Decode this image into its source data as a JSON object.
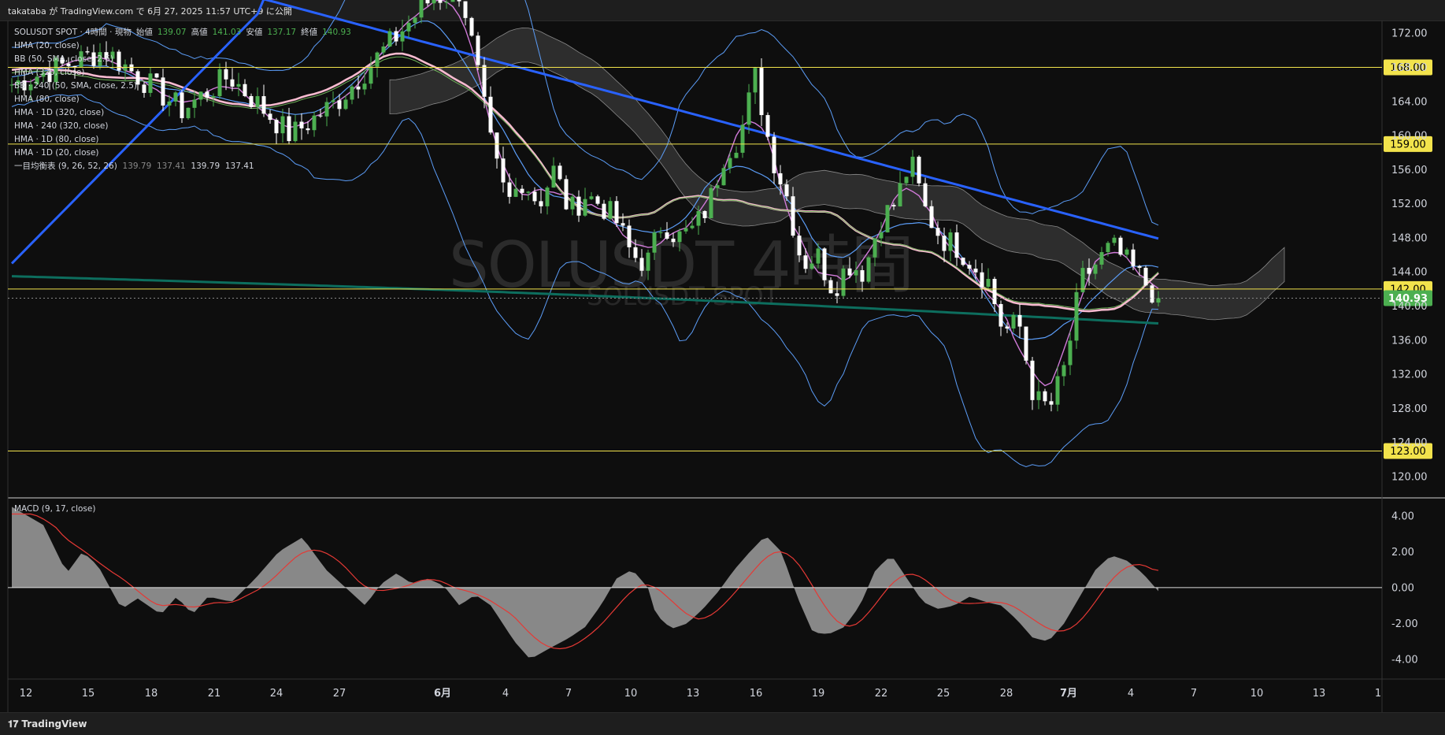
{
  "header": {
    "publish_text": "takataba が TradingView.com で 6月 27, 2025 11:57 UTC+9 に公開"
  },
  "legend": {
    "symbol": "SOLUSDT SPOT · 4時間 · 現物",
    "open_label": "始値",
    "open": "139.07",
    "high_label": "高値",
    "high": "141.03",
    "low_label": "安値",
    "low": "137.17",
    "close_label": "終値",
    "close": "140.93",
    "indicators": [
      "HMA (20, close)",
      "BB (50, SMA, close, 2.5)",
      "HMA (320, close)",
      "BB · 240 (50, SMA, close, 2.5)",
      "HMA (80, close)",
      "HMA · 1D (320, close)",
      "HMA · 240 (320, close)",
      "HMA · 1D (80, close)",
      "HMA · 1D (20, close)"
    ],
    "ichimoku_label": "一目均衡表 (9, 26, 52, 26)",
    "ichimoku_values": [
      "139.79",
      "137.41",
      "139.79",
      "137.41"
    ]
  },
  "watermark": {
    "main": "SOLUSDT 4時間",
    "sub": "SOLUSDT SPOT"
  },
  "macd_label": "MACD (9, 17, close)",
  "footer": {
    "brand": "TradingView"
  },
  "colors": {
    "bg": "#0e0e0e",
    "up": "#4caf50",
    "down": "#ffffff",
    "hline": "#f2e34c",
    "hma_blue": "#2962ff",
    "hma_pink": "#f8bbd0",
    "hma_teal": "#0d6e5e",
    "bb": "#5b9cf6",
    "magenta": "#d07ad8",
    "green_ma": "#6fb25a",
    "cloud": "#3a3a3a",
    "macd_hist": "#9e9e9e",
    "signal": "#e53935",
    "price_tag": "#4caf50"
  },
  "chart_data": {
    "type": "candlestick",
    "x_axis_labels": [
      "12",
      "15",
      "18",
      "21",
      "24",
      "27",
      "6月",
      "4",
      "7",
      "10",
      "13",
      "16",
      "19",
      "22",
      "25",
      "28",
      "7月",
      "4",
      "7",
      "10",
      "13",
      "1"
    ],
    "y_ticks": [
      "172.00",
      "168.00",
      "164.00",
      "160.00",
      "156.00",
      "152.00",
      "148.00",
      "144.00",
      "140.00",
      "136.00",
      "132.00",
      "128.00",
      "124.00",
      "120.00"
    ],
    "y_range": [
      117.5,
      173.5
    ],
    "horizontal_levels": [
      "168.00",
      "159.00",
      "142.00",
      "123.00"
    ],
    "current_price": "140.93",
    "close_path": [
      [
        0,
        166
      ],
      [
        6,
        170
      ],
      [
        11,
        163
      ],
      [
        14,
        167
      ],
      [
        18,
        160
      ],
      [
        21,
        164
      ],
      [
        24,
        170
      ],
      [
        27,
        176
      ],
      [
        29,
        177
      ],
      [
        30,
        168
      ],
      [
        31,
        158
      ],
      [
        32,
        152
      ],
      [
        33,
        155
      ],
      [
        34,
        152
      ],
      [
        35,
        156
      ],
      [
        36,
        151
      ],
      [
        37,
        153
      ],
      [
        38,
        152
      ],
      [
        39,
        150
      ],
      [
        40,
        146
      ],
      [
        41,
        145
      ],
      [
        42,
        150
      ],
      [
        43,
        148
      ],
      [
        44,
        149
      ],
      [
        45,
        152
      ],
      [
        46,
        158
      ],
      [
        47,
        160
      ],
      [
        48,
        167
      ],
      [
        49,
        158
      ],
      [
        50,
        153
      ],
      [
        51,
        145
      ],
      [
        52,
        146
      ],
      [
        53,
        142
      ],
      [
        54,
        145
      ],
      [
        55,
        144
      ],
      [
        56,
        150
      ],
      [
        57,
        152
      ],
      [
        58,
        157
      ],
      [
        59,
        151
      ],
      [
        60,
        148
      ],
      [
        61,
        147
      ],
      [
        62,
        145
      ],
      [
        63,
        143
      ],
      [
        64,
        137
      ],
      [
        65,
        138
      ],
      [
        66,
        129
      ],
      [
        67,
        128
      ],
      [
        68,
        133
      ],
      [
        69,
        143
      ],
      [
        70,
        145
      ],
      [
        71,
        147
      ],
      [
        72,
        145
      ],
      [
        73,
        143
      ],
      [
        74,
        140.93
      ]
    ],
    "macd": {
      "label": "MACD (9, 17, close)",
      "y_ticks": [
        "4.00",
        "2.00",
        "0.00",
        "-2.00",
        "-4.00"
      ],
      "y_range": [
        -5.1,
        5.0
      ],
      "hist_path": [
        [
          0,
          4.5
        ],
        [
          2,
          3.5
        ],
        [
          3.5,
          0.8
        ],
        [
          4.5,
          2
        ],
        [
          5.5,
          1.2
        ],
        [
          7,
          -1.2
        ],
        [
          8,
          -0.6
        ],
        [
          9.5,
          -1.5
        ],
        [
          10.5,
          -0.5
        ],
        [
          11.5,
          -1.5
        ],
        [
          12.5,
          -0.5
        ],
        [
          14,
          -0.8
        ],
        [
          15.5,
          0.5
        ],
        [
          17,
          2
        ],
        [
          18.5,
          2.8
        ],
        [
          20,
          1
        ],
        [
          21.5,
          -0.2
        ],
        [
          22.5,
          -1
        ],
        [
          23.5,
          0.2
        ],
        [
          24.5,
          0.8
        ],
        [
          25.5,
          0.2
        ],
        [
          26.5,
          0.5
        ],
        [
          27.5,
          0.1
        ],
        [
          28.5,
          -1
        ],
        [
          29.5,
          -0.4
        ],
        [
          30.5,
          -1
        ],
        [
          32,
          -3
        ],
        [
          33,
          -4
        ],
        [
          34,
          -3.5
        ],
        [
          35.5,
          -2.8
        ],
        [
          36.5,
          -2.2
        ],
        [
          37.5,
          -1
        ],
        [
          38.5,
          0.5
        ],
        [
          39.5,
          1
        ],
        [
          40.5,
          0
        ],
        [
          41,
          -1.5
        ],
        [
          42,
          -2.3
        ],
        [
          43,
          -2
        ],
        [
          44,
          -1.2
        ],
        [
          45,
          -0.2
        ],
        [
          46,
          1
        ],
        [
          47,
          2
        ],
        [
          48,
          2.9
        ],
        [
          49,
          2
        ],
        [
          50,
          -0.5
        ],
        [
          51,
          -2.5
        ],
        [
          52,
          -2.6
        ],
        [
          53,
          -2.2
        ],
        [
          54,
          -1
        ],
        [
          55,
          1
        ],
        [
          56,
          1.8
        ],
        [
          57,
          0.5
        ],
        [
          58,
          -0.8
        ],
        [
          59,
          -1.2
        ],
        [
          60,
          -1
        ],
        [
          61,
          -0.5
        ],
        [
          62,
          -0.8
        ],
        [
          63,
          -1
        ],
        [
          64,
          -1.8
        ],
        [
          65,
          -2.8
        ],
        [
          66,
          -3
        ],
        [
          67,
          -2
        ],
        [
          68,
          -0.5
        ],
        [
          69,
          1
        ],
        [
          70,
          1.8
        ],
        [
          71,
          1.5
        ],
        [
          72,
          0.8
        ],
        [
          73,
          -0.2
        ]
      ]
    }
  }
}
